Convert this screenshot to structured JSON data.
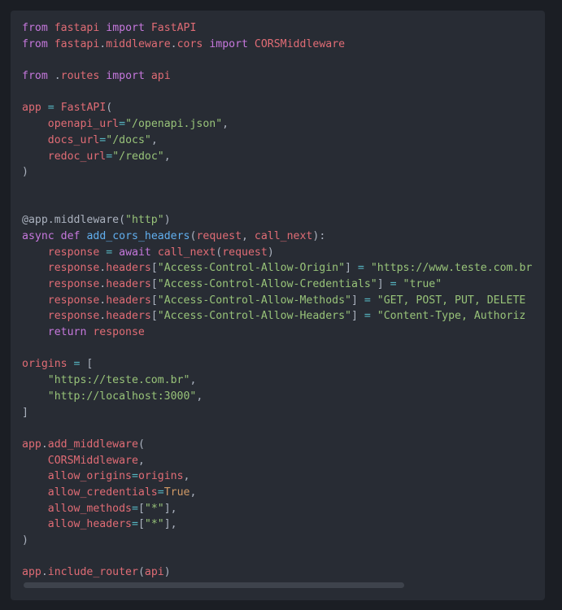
{
  "code_block": {
    "language": "python",
    "colors": {
      "background": "#282c34",
      "page_background": "#1b1e24",
      "keyword": "#c678dd",
      "identifier": "#e06c75",
      "string": "#98c379",
      "operator": "#56b6c2",
      "function": "#61afef",
      "constant": "#d19a66",
      "punctuation": "#abb2bf"
    },
    "lines": [
      [
        [
          "kw",
          "from"
        ],
        [
          "p",
          " "
        ],
        [
          "id",
          "fastapi"
        ],
        [
          "p",
          " "
        ],
        [
          "kw",
          "import"
        ],
        [
          "p",
          " "
        ],
        [
          "id",
          "FastAPI"
        ]
      ],
      [
        [
          "kw",
          "from"
        ],
        [
          "p",
          " "
        ],
        [
          "id",
          "fastapi"
        ],
        [
          "p",
          "."
        ],
        [
          "id",
          "middleware"
        ],
        [
          "p",
          "."
        ],
        [
          "id",
          "cors"
        ],
        [
          "p",
          " "
        ],
        [
          "kw",
          "import"
        ],
        [
          "p",
          " "
        ],
        [
          "id",
          "CORSMiddleware"
        ]
      ],
      [],
      [
        [
          "kw",
          "from"
        ],
        [
          "p",
          " ."
        ],
        [
          "id",
          "routes"
        ],
        [
          "p",
          " "
        ],
        [
          "kw",
          "import"
        ],
        [
          "p",
          " "
        ],
        [
          "id",
          "api"
        ]
      ],
      [],
      [
        [
          "id",
          "app"
        ],
        [
          "p",
          " "
        ],
        [
          "op",
          "="
        ],
        [
          "p",
          " "
        ],
        [
          "id",
          "FastAPI"
        ],
        [
          "p",
          "("
        ]
      ],
      [
        [
          "p",
          "    "
        ],
        [
          "id",
          "openapi_url"
        ],
        [
          "op",
          "="
        ],
        [
          "str",
          "\"/openapi.json\""
        ],
        [
          "p",
          ","
        ]
      ],
      [
        [
          "p",
          "    "
        ],
        [
          "id",
          "docs_url"
        ],
        [
          "op",
          "="
        ],
        [
          "str",
          "\"/docs\""
        ],
        [
          "p",
          ","
        ]
      ],
      [
        [
          "p",
          "    "
        ],
        [
          "id",
          "redoc_url"
        ],
        [
          "op",
          "="
        ],
        [
          "str",
          "\"/redoc\""
        ],
        [
          "p",
          ","
        ]
      ],
      [
        [
          "p",
          ")"
        ]
      ],
      [],
      [],
      [
        [
          "dec",
          "@app.middleware("
        ],
        [
          "str",
          "\"http\""
        ],
        [
          "dec",
          ")"
        ]
      ],
      [
        [
          "kw",
          "async"
        ],
        [
          "p",
          " "
        ],
        [
          "kw",
          "def"
        ],
        [
          "p",
          " "
        ],
        [
          "fn",
          "add_cors_headers"
        ],
        [
          "p",
          "("
        ],
        [
          "id",
          "request"
        ],
        [
          "p",
          ", "
        ],
        [
          "id",
          "call_next"
        ],
        [
          "p",
          "):"
        ]
      ],
      [
        [
          "p",
          "    "
        ],
        [
          "id",
          "response"
        ],
        [
          "p",
          " "
        ],
        [
          "op",
          "="
        ],
        [
          "p",
          " "
        ],
        [
          "kw",
          "await"
        ],
        [
          "p",
          " "
        ],
        [
          "id",
          "call_next"
        ],
        [
          "p",
          "("
        ],
        [
          "id",
          "request"
        ],
        [
          "p",
          ")"
        ]
      ],
      [
        [
          "p",
          "    "
        ],
        [
          "id",
          "response"
        ],
        [
          "p",
          "."
        ],
        [
          "id",
          "headers"
        ],
        [
          "p",
          "["
        ],
        [
          "str",
          "\"Access-Control-Allow-Origin\""
        ],
        [
          "p",
          "] "
        ],
        [
          "op",
          "="
        ],
        [
          "p",
          " "
        ],
        [
          "str",
          "\"https://www.teste.com.br\""
        ]
      ],
      [
        [
          "p",
          "    "
        ],
        [
          "id",
          "response"
        ],
        [
          "p",
          "."
        ],
        [
          "id",
          "headers"
        ],
        [
          "p",
          "["
        ],
        [
          "str",
          "\"Access-Control-Allow-Credentials\""
        ],
        [
          "p",
          "] "
        ],
        [
          "op",
          "="
        ],
        [
          "p",
          " "
        ],
        [
          "str",
          "\"true\""
        ]
      ],
      [
        [
          "p",
          "    "
        ],
        [
          "id",
          "response"
        ],
        [
          "p",
          "."
        ],
        [
          "id",
          "headers"
        ],
        [
          "p",
          "["
        ],
        [
          "str",
          "\"Access-Control-Allow-Methods\""
        ],
        [
          "p",
          "] "
        ],
        [
          "op",
          "="
        ],
        [
          "p",
          " "
        ],
        [
          "str",
          "\"GET, POST, PUT, DELETE"
        ]
      ],
      [
        [
          "p",
          "    "
        ],
        [
          "id",
          "response"
        ],
        [
          "p",
          "."
        ],
        [
          "id",
          "headers"
        ],
        [
          "p",
          "["
        ],
        [
          "str",
          "\"Access-Control-Allow-Headers\""
        ],
        [
          "p",
          "] "
        ],
        [
          "op",
          "="
        ],
        [
          "p",
          " "
        ],
        [
          "str",
          "\"Content-Type, Authoriz"
        ]
      ],
      [
        [
          "p",
          "    "
        ],
        [
          "kw",
          "return"
        ],
        [
          "p",
          " "
        ],
        [
          "id",
          "response"
        ]
      ],
      [],
      [
        [
          "id",
          "origins"
        ],
        [
          "p",
          " "
        ],
        [
          "op",
          "="
        ],
        [
          "p",
          " ["
        ]
      ],
      [
        [
          "p",
          "    "
        ],
        [
          "str",
          "\"https://teste.com.br\""
        ],
        [
          "p",
          ","
        ]
      ],
      [
        [
          "p",
          "    "
        ],
        [
          "str",
          "\"http://localhost:3000\""
        ],
        [
          "p",
          ","
        ]
      ],
      [
        [
          "p",
          "]"
        ]
      ],
      [],
      [
        [
          "id",
          "app"
        ],
        [
          "p",
          "."
        ],
        [
          "id",
          "add_middleware"
        ],
        [
          "p",
          "("
        ]
      ],
      [
        [
          "p",
          "    "
        ],
        [
          "id",
          "CORSMiddleware"
        ],
        [
          "p",
          ","
        ]
      ],
      [
        [
          "p",
          "    "
        ],
        [
          "id",
          "allow_origins"
        ],
        [
          "op",
          "="
        ],
        [
          "id",
          "origins"
        ],
        [
          "p",
          ","
        ]
      ],
      [
        [
          "p",
          "    "
        ],
        [
          "id",
          "allow_credentials"
        ],
        [
          "op",
          "="
        ],
        [
          "num",
          "True"
        ],
        [
          "p",
          ","
        ]
      ],
      [
        [
          "p",
          "    "
        ],
        [
          "id",
          "allow_methods"
        ],
        [
          "op",
          "="
        ],
        [
          "p",
          "["
        ],
        [
          "str",
          "\"*\""
        ],
        [
          "p",
          "],"
        ]
      ],
      [
        [
          "p",
          "    "
        ],
        [
          "id",
          "allow_headers"
        ],
        [
          "op",
          "="
        ],
        [
          "p",
          "["
        ],
        [
          "str",
          "\"*\""
        ],
        [
          "p",
          "],"
        ]
      ],
      [
        [
          "p",
          ")"
        ]
      ],
      [],
      [
        [
          "id",
          "app"
        ],
        [
          "p",
          "."
        ],
        [
          "id",
          "include_router"
        ],
        [
          "p",
          "("
        ],
        [
          "id",
          "api"
        ],
        [
          "p",
          ")"
        ]
      ]
    ],
    "horizontal_scroll_fraction": 0.74
  }
}
